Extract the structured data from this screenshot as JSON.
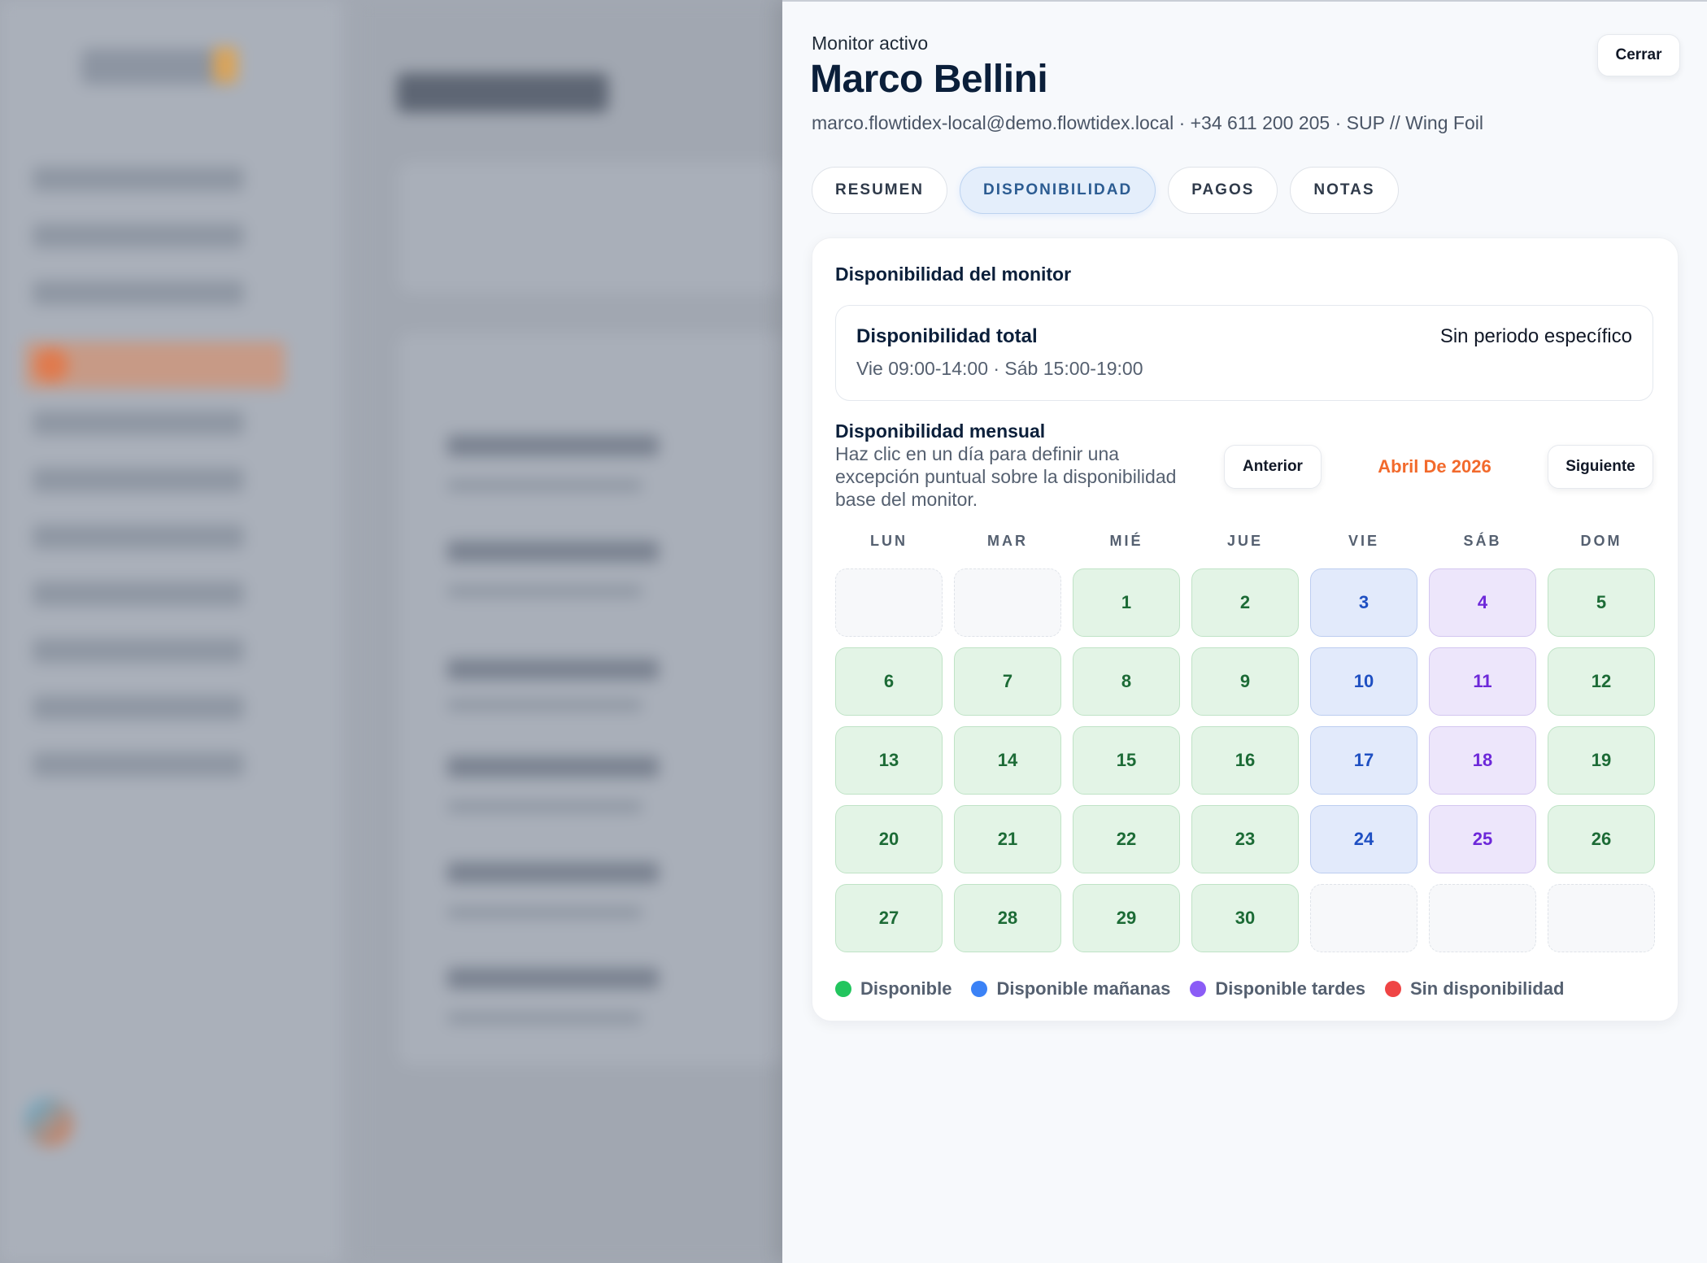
{
  "drawer": {
    "eyebrow": "Monitor activo",
    "name": "Marco Bellini",
    "meta": "marco.flowtidex-local@demo.flowtidex.local · +34 611 200 205 · SUP // Wing Foil",
    "close_label": "Cerrar"
  },
  "tabs": [
    {
      "label": "RESUMEN",
      "active": false
    },
    {
      "label": "DISPONIBILIDAD",
      "active": true
    },
    {
      "label": "PAGOS",
      "active": false
    },
    {
      "label": "NOTAS",
      "active": false
    }
  ],
  "availability": {
    "title": "Disponibilidad del monitor",
    "total": {
      "title": "Disponibilidad total",
      "period": "Sin periodo específico",
      "schedule": "Vie 09:00-14:00 · Sáb 15:00-19:00"
    },
    "monthly": {
      "title": "Disponibilidad mensual",
      "description": "Haz clic en un día para definir una excepción puntual sobre la disponibilidad base del monitor.",
      "prev_label": "Anterior",
      "next_label": "Siguiente",
      "month_label": "Abril De 2026"
    },
    "weekdays": [
      "LUN",
      "MAR",
      "MIÉ",
      "JUE",
      "VIE",
      "SÁB",
      "DOM"
    ],
    "days": [
      {
        "day": "",
        "status": "empty"
      },
      {
        "day": "",
        "status": "empty"
      },
      {
        "day": "1",
        "status": "available"
      },
      {
        "day": "2",
        "status": "available"
      },
      {
        "day": "3",
        "status": "mornings"
      },
      {
        "day": "4",
        "status": "afternoons"
      },
      {
        "day": "5",
        "status": "available"
      },
      {
        "day": "6",
        "status": "available"
      },
      {
        "day": "7",
        "status": "available"
      },
      {
        "day": "8",
        "status": "available"
      },
      {
        "day": "9",
        "status": "available"
      },
      {
        "day": "10",
        "status": "mornings"
      },
      {
        "day": "11",
        "status": "afternoons"
      },
      {
        "day": "12",
        "status": "available"
      },
      {
        "day": "13",
        "status": "available"
      },
      {
        "day": "14",
        "status": "available"
      },
      {
        "day": "15",
        "status": "available"
      },
      {
        "day": "16",
        "status": "available"
      },
      {
        "day": "17",
        "status": "mornings"
      },
      {
        "day": "18",
        "status": "afternoons"
      },
      {
        "day": "19",
        "status": "available"
      },
      {
        "day": "20",
        "status": "available"
      },
      {
        "day": "21",
        "status": "available"
      },
      {
        "day": "22",
        "status": "available"
      },
      {
        "day": "23",
        "status": "available"
      },
      {
        "day": "24",
        "status": "mornings"
      },
      {
        "day": "25",
        "status": "afternoons"
      },
      {
        "day": "26",
        "status": "available"
      },
      {
        "day": "27",
        "status": "available"
      },
      {
        "day": "28",
        "status": "available"
      },
      {
        "day": "29",
        "status": "available"
      },
      {
        "day": "30",
        "status": "available"
      },
      {
        "day": "",
        "status": "empty"
      },
      {
        "day": "",
        "status": "empty"
      },
      {
        "day": "",
        "status": "empty"
      }
    ],
    "legend": [
      {
        "label": "Disponible",
        "color": "#22c55e"
      },
      {
        "label": "Disponible mañanas",
        "color": "#3b82f6"
      },
      {
        "label": "Disponible tardes",
        "color": "#8b5cf6"
      },
      {
        "label": "Sin disponibilidad",
        "color": "#ef4444"
      }
    ]
  },
  "colors": {
    "accent_orange": "#f26a2c",
    "active_tab_text": "#2c5c92"
  }
}
